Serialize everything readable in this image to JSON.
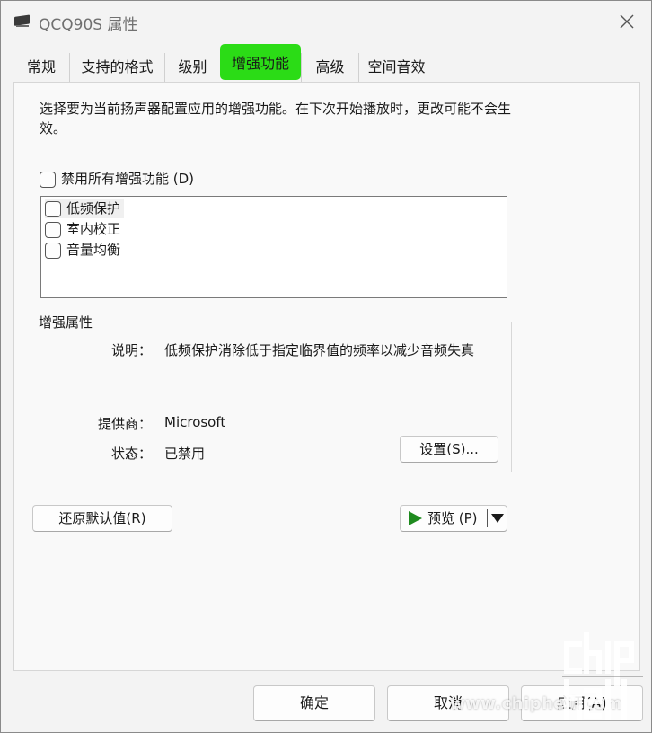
{
  "window": {
    "title": "QCQ90S 属性",
    "icon": "speaker-device-icon",
    "close_icon": "close-icon"
  },
  "tabs": [
    {
      "label": "常规"
    },
    {
      "label": "支持的格式"
    },
    {
      "label": "级别"
    },
    {
      "label": "增强功能",
      "active": true
    },
    {
      "label": "高级"
    },
    {
      "label": "空间音效"
    }
  ],
  "highlight_color": "#2bdc16",
  "enhancements": {
    "description": "选择要为当前扬声器配置应用的增强功能。在下次开始播放时，更改可能不会生效。",
    "disable_all_label": "禁用所有增强功能 (D)",
    "disable_all_checked": false,
    "items": [
      {
        "label": "低频保护",
        "checked": false,
        "selected": true
      },
      {
        "label": "室内校正",
        "checked": false
      },
      {
        "label": "音量均衡",
        "checked": false
      }
    ]
  },
  "properties": {
    "group_title": "增强属性",
    "description_label": "说明：",
    "description_value": "低频保护消除低于指定临界值的频率以减少音频失真",
    "provider_label": "提供商：",
    "provider_value": "Microsoft",
    "status_label": "状态：",
    "status_value": "已禁用",
    "settings_button": "设置(S)..."
  },
  "actions": {
    "restore_defaults": "还原默认值(R)",
    "preview_label": "预览 (P)",
    "preview_icon": "play-icon",
    "preview_dropdown_icon": "chevron-down-icon",
    "ok": "确定",
    "cancel": "取消",
    "apply": "应用(A)"
  },
  "watermark": {
    "text": "www.chiphell.com",
    "logo": "chiphell-logo"
  }
}
